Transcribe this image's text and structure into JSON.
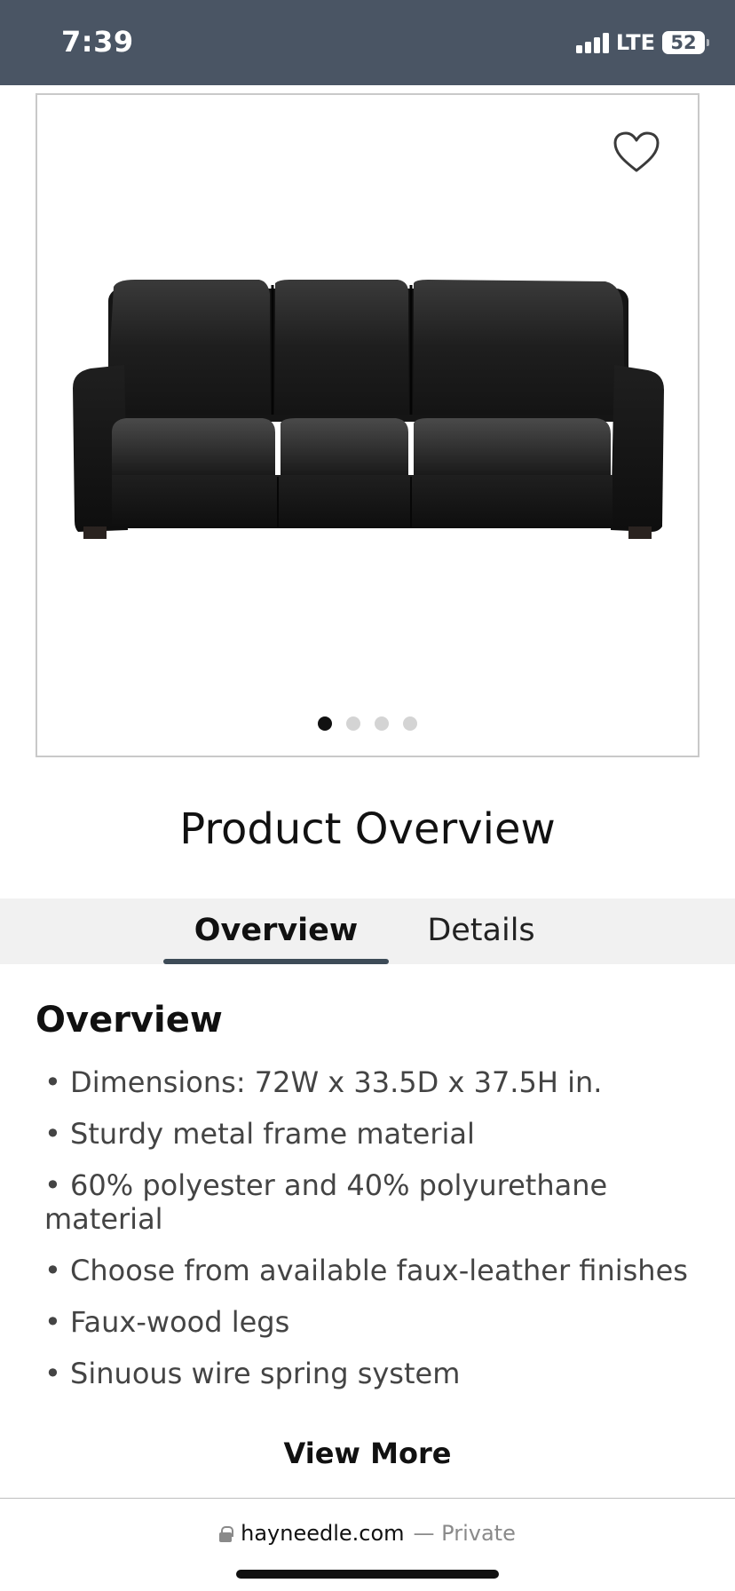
{
  "status_bar": {
    "time": "7:39",
    "network": "LTE",
    "battery": "52",
    "icons": [
      "signal-icon",
      "battery-icon"
    ]
  },
  "gallery": {
    "favorite_icon": "heart-outline-icon",
    "image_label": "sofa-image",
    "slide_count": 4,
    "active_slide": 1
  },
  "page_title": "Product Overview",
  "tabs": [
    {
      "label": "Overview",
      "active": true
    },
    {
      "label": "Details",
      "active": false
    }
  ],
  "overview": {
    "title": "Overview",
    "bullets": [
      "• Dimensions: 72W x 33.5D x 37.5H in.",
      "• Sturdy metal frame material",
      "• 60% polyester and 40% polyurethane material",
      "• Choose from available faux-leather finishes",
      "• Faux-wood legs",
      "• Sinuous wire spring system"
    ],
    "view_more": "View More"
  },
  "browser": {
    "domain": "hayneedle.com",
    "private_label": "— Private",
    "lock_icon": "lock-icon"
  },
  "colors": {
    "status_bar": "#4a5564",
    "tab_bar": "#f1f1f1",
    "tab_underline": "#3d4b57"
  }
}
